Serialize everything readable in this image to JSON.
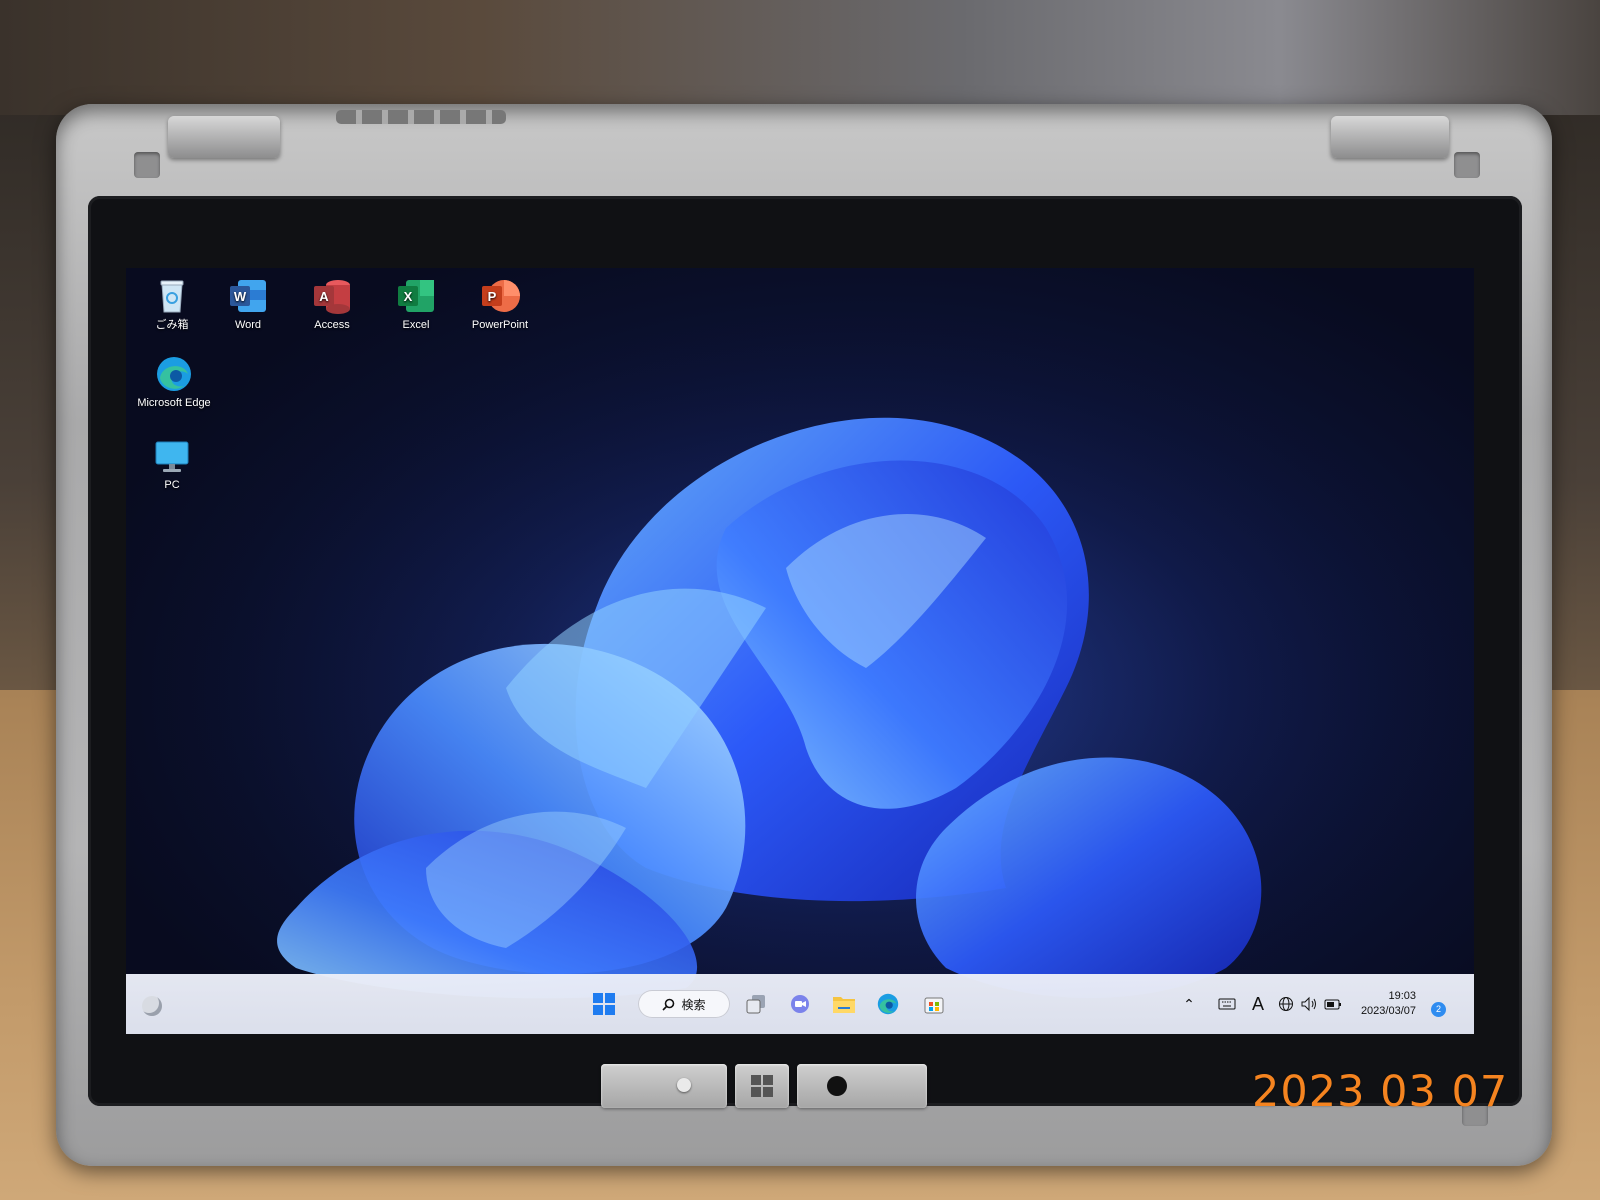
{
  "photo": {
    "date_stamp": "2023 03 07",
    "date_stamp_color": "#f58420"
  },
  "desktop": {
    "icons": [
      {
        "label": "ごみ箱",
        "icon": "recycle-bin-icon"
      },
      {
        "label": "Word",
        "icon": "word-icon"
      },
      {
        "label": "Access",
        "icon": "access-icon"
      },
      {
        "label": "Excel",
        "icon": "excel-icon"
      },
      {
        "label": "PowerPoint",
        "icon": "powerpoint-icon"
      },
      {
        "label": "Microsoft Edge",
        "icon": "edge-icon"
      },
      {
        "label": "PC",
        "icon": "pc-monitor-icon"
      }
    ]
  },
  "taskbar": {
    "search_label": "検索",
    "apps": [
      "start-icon",
      "search-icon",
      "task-view-icon",
      "chat-icon",
      "file-explorer-icon",
      "edge-icon",
      "store-icon"
    ],
    "tray": {
      "ime_label": "A",
      "time": "19:03",
      "date": "2023/03/07",
      "notification_count": "2"
    }
  },
  "colors": {
    "accent": "#2f6bff",
    "taskbar": "#e8ebf5",
    "word": "#2b579a",
    "access": "#a4373a",
    "excel": "#217346",
    "powerpoint": "#d24726"
  }
}
